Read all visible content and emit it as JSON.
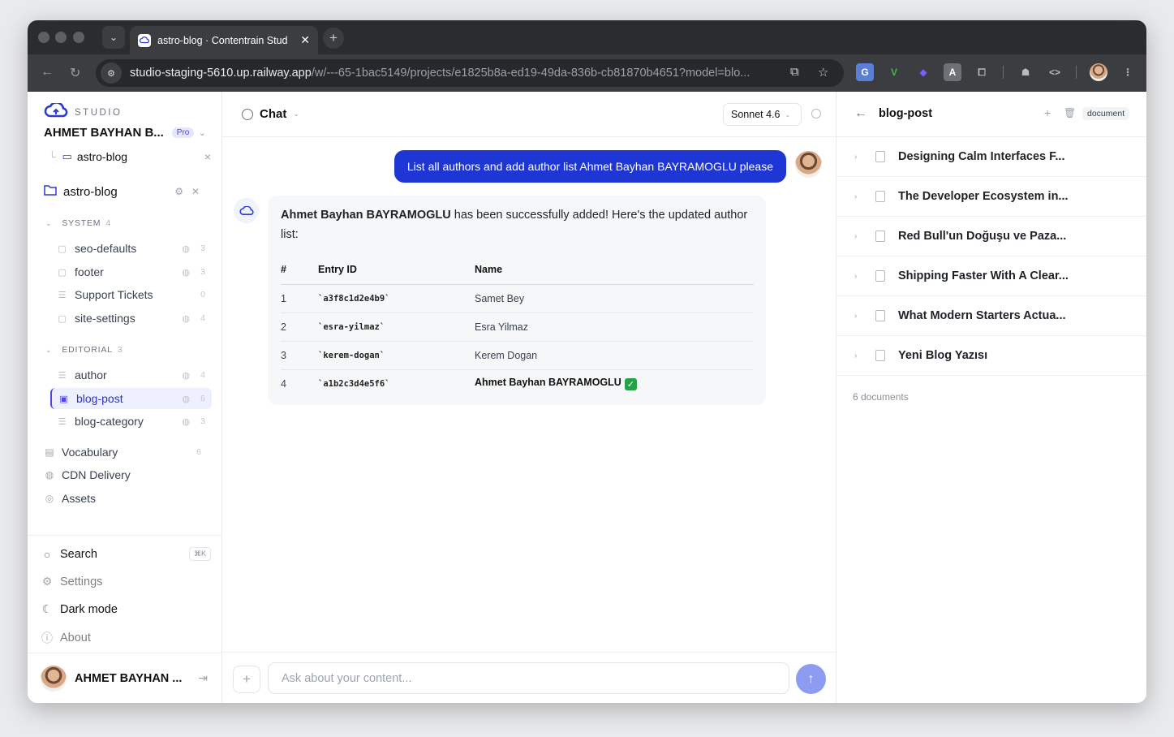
{
  "browser": {
    "tab_title": "astro-blog · Contentrain Stud",
    "url_host": "studio-staging-5610.up.railway.app",
    "url_path": "/w/---65-1bac5149/projects/e1825b8a-ed19-49da-836b-cb81870b4651?model=blo..."
  },
  "sidebar": {
    "brand": "STUDIO",
    "workspace_name": "AHMET BAYHAN B...",
    "plan_badge": "Pro",
    "project_small": "astro-blog",
    "project_main": "astro-blog",
    "sections": [
      {
        "label": "SYSTEM",
        "count": "4",
        "items": [
          {
            "label": "seo-defaults",
            "count": "3"
          },
          {
            "label": "footer",
            "count": "3"
          },
          {
            "label": "Support Tickets",
            "count": "0"
          },
          {
            "label": "site-settings",
            "count": "4"
          }
        ]
      },
      {
        "label": "EDITORIAL",
        "count": "3",
        "items": [
          {
            "label": "author",
            "count": "4"
          },
          {
            "label": "blog-post",
            "count": "6"
          },
          {
            "label": "blog-category",
            "count": "3"
          }
        ]
      }
    ],
    "utilities": [
      {
        "label": "Vocabulary",
        "count": "6"
      },
      {
        "label": "CDN Delivery"
      },
      {
        "label": "Assets"
      }
    ],
    "bottom": {
      "search_label": "Search",
      "search_shortcut": "⌘K",
      "settings_label": "Settings",
      "dark_mode_label": "Dark mode",
      "about_label": "About"
    },
    "user_name": "AHMET BAYHAN ..."
  },
  "chat": {
    "title": "Chat",
    "model": "Sonnet 4.6",
    "user_message": "List all authors and add author list Ahmet Bayhan BAYRAMOGLU please",
    "reply_bold": "Ahmet Bayhan BAYRAMOGLU",
    "reply_text": " has been successfully added! Here's the updated author list:",
    "table": {
      "headers": [
        "#",
        "Entry ID",
        "Name"
      ],
      "rows": [
        {
          "num": "1",
          "id": "`a3f8c1d2e4b9`",
          "name": "Samet Bey"
        },
        {
          "num": "2",
          "id": "`esra-yilmaz`",
          "name": "Esra Yilmaz"
        },
        {
          "num": "3",
          "id": "`kerem-dogan`",
          "name": "Kerem Dogan"
        },
        {
          "num": "4",
          "id": "`a1b2c3d4e5f6`",
          "name": "Ahmet Bayhan BAYRAMOGLU"
        }
      ]
    },
    "input_placeholder": "Ask about your content..."
  },
  "right_panel": {
    "model_name": "blog-post",
    "kind_badge": "document",
    "documents": [
      "Designing Calm Interfaces F...",
      "The Developer Ecosystem in...",
      "Red Bull'un Doğuşu ve Paza...",
      "Shipping Faster With A Clear...",
      "What Modern Starters Actua...",
      "Yeni Blog Yazısı"
    ],
    "doc_count": "6 documents"
  },
  "colors": {
    "accent": "#1e36d4",
    "send_button": "#8d9cf1",
    "active_nav_bg": "#eef0ff"
  }
}
